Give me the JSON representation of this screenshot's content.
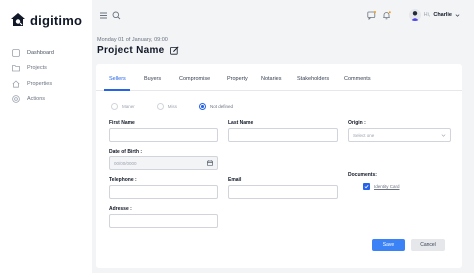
{
  "app": {
    "brand": "digitimo"
  },
  "sidebar": {
    "items": [
      {
        "label": "Dashboard",
        "icon": "grid-icon"
      },
      {
        "label": "Projects",
        "icon": "folder-icon"
      },
      {
        "label": "Properties",
        "icon": "home-icon"
      },
      {
        "label": "Actions",
        "icon": "target-icon"
      }
    ]
  },
  "header": {
    "greeting": "Hi,",
    "user_name": "Charlie"
  },
  "page": {
    "date": "Monday 01 of January, 09:00",
    "title": "Project Name"
  },
  "tabs": [
    "Sellers",
    "Buyers",
    "Compromise",
    "Property",
    "Notaries",
    "Stakeholders",
    "Comments"
  ],
  "active_tab": "Sellers",
  "radios": [
    {
      "label": "Maner",
      "checked": false
    },
    {
      "label": "Miss",
      "checked": false
    },
    {
      "label": "Not defined",
      "checked": true
    }
  ],
  "form": {
    "first_name": {
      "label": "First Name",
      "value": ""
    },
    "last_name": {
      "label": "Last Name",
      "value": ""
    },
    "origin": {
      "label": "Origin :",
      "placeholder": "Select one"
    },
    "dob": {
      "label": "Date of Birth :",
      "placeholder": "00/00/0000"
    },
    "telephone": {
      "label": "Telephone :",
      "value": ""
    },
    "email": {
      "label": "Email",
      "value": ""
    },
    "documents": {
      "label": "Documents:",
      "item": "Identity Card",
      "checked": true
    },
    "address": {
      "label": "Adresse :",
      "value": ""
    }
  },
  "buttons": {
    "save": "Save",
    "cancel": "Cancel"
  },
  "colors": {
    "accent": "#2563eb",
    "primary_button": "#3b82f6",
    "notification_dot": "#f59e0b"
  }
}
